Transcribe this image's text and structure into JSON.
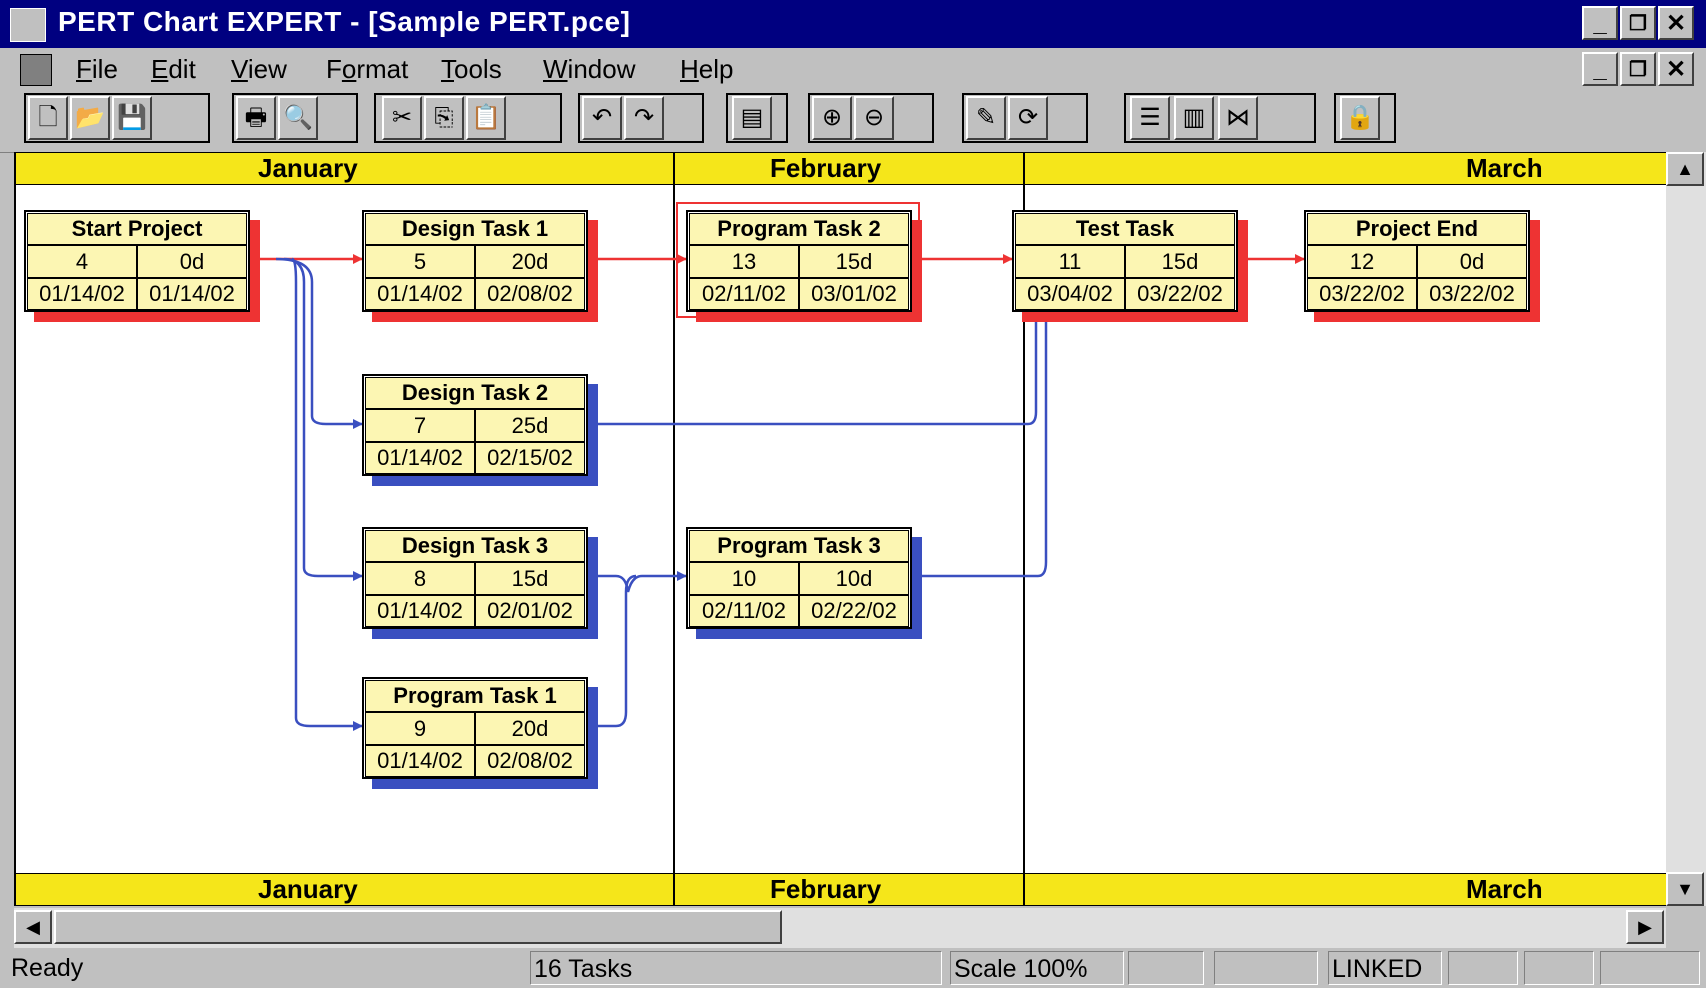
{
  "window": {
    "title": "PERT Chart EXPERT - [Sample PERT.pce]"
  },
  "menu": [
    {
      "label": "File",
      "key": "F"
    },
    {
      "label": "Edit",
      "key": "E"
    },
    {
      "label": "View",
      "key": "V"
    },
    {
      "label": "Format",
      "key": "o"
    },
    {
      "label": "Tools",
      "key": "T"
    },
    {
      "label": "Window",
      "key": "W"
    },
    {
      "label": "Help",
      "key": "H"
    }
  ],
  "toolbar": [
    {
      "name": "new-icon",
      "glyph": "🗋"
    },
    {
      "name": "open-icon",
      "glyph": "📂"
    },
    {
      "name": "save-icon",
      "glyph": "💾"
    },
    {
      "name": "print-icon",
      "glyph": "🖶"
    },
    {
      "name": "print-preview-icon",
      "glyph": "🔍"
    },
    {
      "name": "cut-icon",
      "glyph": "✂"
    },
    {
      "name": "copy-icon",
      "glyph": "⎘"
    },
    {
      "name": "paste-icon",
      "glyph": "📋"
    },
    {
      "name": "undo-icon",
      "glyph": "↶"
    },
    {
      "name": "redo-icon",
      "glyph": "↷"
    },
    {
      "name": "task-info-icon",
      "glyph": "▤"
    },
    {
      "name": "zoom-in-icon",
      "glyph": "⊕"
    },
    {
      "name": "zoom-out-icon",
      "glyph": "⊖"
    },
    {
      "name": "link-tasks-icon",
      "glyph": "✎"
    },
    {
      "name": "refresh-icon",
      "glyph": "⟳"
    },
    {
      "name": "row-layout-icon",
      "glyph": "☰"
    },
    {
      "name": "column-layout-icon",
      "glyph": "▥"
    },
    {
      "name": "compress-icon",
      "glyph": "⋈"
    },
    {
      "name": "lock-icon",
      "glyph": "🔒"
    }
  ],
  "timeline": {
    "months": [
      "January",
      "February",
      "March"
    ]
  },
  "tasks": [
    {
      "name": "Start Project",
      "id": "4",
      "duration": "0d",
      "start": "01/14/02",
      "end": "01/14/02",
      "critical": true
    },
    {
      "name": "Design Task 1",
      "id": "5",
      "duration": "20d",
      "start": "01/14/02",
      "end": "02/08/02",
      "critical": true
    },
    {
      "name": "Program Task 2",
      "id": "13",
      "duration": "15d",
      "start": "02/11/02",
      "end": "03/01/02",
      "critical": true
    },
    {
      "name": "Test Task",
      "id": "11",
      "duration": "15d",
      "start": "03/04/02",
      "end": "03/22/02",
      "critical": true
    },
    {
      "name": "Project End",
      "id": "12",
      "duration": "0d",
      "start": "03/22/02",
      "end": "03/22/02",
      "critical": true
    },
    {
      "name": "Design Task 2",
      "id": "7",
      "duration": "25d",
      "start": "01/14/02",
      "end": "02/15/02",
      "critical": false
    },
    {
      "name": "Design Task 3",
      "id": "8",
      "duration": "15d",
      "start": "01/14/02",
      "end": "02/01/02",
      "critical": false
    },
    {
      "name": "Program Task 3",
      "id": "10",
      "duration": "10d",
      "start": "02/11/02",
      "end": "02/22/02",
      "critical": false
    },
    {
      "name": "Program Task 1",
      "id": "9",
      "duration": "20d",
      "start": "01/14/02",
      "end": "02/08/02",
      "critical": false
    }
  ],
  "colors": {
    "critical": "#ee3333",
    "noncritical": "#3a4fc0",
    "monthbar": "#f5e61a",
    "cell": "#fcf6b3"
  },
  "status": {
    "ready": "Ready",
    "tasks": "16 Tasks",
    "scale": "Scale 100%",
    "linked": "LINKED"
  }
}
